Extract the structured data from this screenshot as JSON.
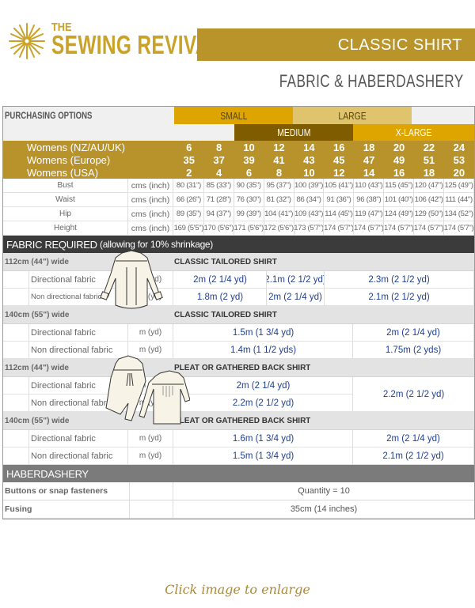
{
  "header": {
    "logo_small": "THE",
    "logo_main": "SEWING REVIVAL",
    "title": "CLASSIC SHIRT",
    "subtitle": "FABRIC & HABERDASHERY"
  },
  "colors": {
    "brand_gold": "#b9942a",
    "small": "#dea400",
    "medium": "#7f5c00",
    "large": "#e0c36d",
    "xlarge": "#dea400",
    "section_dark": "#3b3b3b",
    "section_grey": "#7b7b7b",
    "value_blue": "#1f3f8f"
  },
  "purchasing": {
    "label": "PURCHASING OPTIONS",
    "groups": {
      "small": "SMALL",
      "medium": "MEDIUM",
      "large": "LARGE",
      "xlarge": "X-LARGE"
    }
  },
  "sizes": [
    {
      "label": "Womens (NZ/AU/UK)",
      "values": [
        "6",
        "8",
        "10",
        "12",
        "14",
        "16",
        "18",
        "20",
        "22",
        "24"
      ]
    },
    {
      "label": "Womens (Europe)",
      "values": [
        "35",
        "37",
        "39",
        "41",
        "43",
        "45",
        "47",
        "49",
        "51",
        "53"
      ]
    },
    {
      "label": "Womens (USA)",
      "values": [
        "2",
        "4",
        "6",
        "8",
        "10",
        "12",
        "14",
        "16",
        "18",
        "20"
      ]
    }
  ],
  "measurements": [
    {
      "label": "Bust",
      "unit": "cms (inch)",
      "values": [
        "80 (31\")",
        "85 (33\")",
        "90 (35\")",
        "95 (37\")",
        "100 (39\")",
        "105 (41\")",
        "110 (43\")",
        "115 (45\")",
        "120 (47\")",
        "125 (49\")"
      ]
    },
    {
      "label": "Waist",
      "unit": "cms (inch)",
      "values": [
        "66 (26\")",
        "71 (28\")",
        "76 (30\")",
        "81 (32\")",
        "86 (34\")",
        "91 (36\")",
        "96 (38\")",
        "101 (40\")",
        "106 (42\")",
        "111 (44\")"
      ]
    },
    {
      "label": "Hip",
      "unit": "cms (inch)",
      "values": [
        "89 (35\")",
        "94 (37\")",
        "99 (39\")",
        "104 (41\")",
        "109 (43\")",
        "114 (45\")",
        "119 (47\")",
        "124 (49\")",
        "129 (50\")",
        "134 (52\")"
      ]
    },
    {
      "label": "Height",
      "unit": "cms (inch)",
      "values": [
        "169 (5'5\")",
        "170 (5'6\")",
        "171 (5'6\")",
        "172 (5'6\")",
        "173 (5'7\")",
        "174 (5'7\")",
        "174 (5'7\")",
        "174 (5'7\")",
        "174 (5'7\")",
        "174 (5'7\")"
      ]
    }
  ],
  "fabric": {
    "section_title": "FABRIC REQUIRED",
    "section_note": "(allowing for 10% shrinkage)",
    "blocks": [
      {
        "width": "112cm (44\") wide",
        "style": "CLASSIC TAILORED SHIRT",
        "rows": [
          {
            "label": "Directional fabric",
            "unit": "m (yd)",
            "values": [
              "2m  (2 1/4 yd)",
              "2.1m  (2 1/2 yd)",
              "2.3m (2 1/2 yd)"
            ]
          },
          {
            "label": "Non directional fabric",
            "unit": "m (yd)",
            "values": [
              "1.8m  (2  yd)",
              "2m (2 1/4 yd)",
              "2.1m  (2 1/2 yd)"
            ]
          }
        ]
      },
      {
        "width": "140cm (55\") wide",
        "style": "CLASSIC TAILORED SHIRT",
        "rows": [
          {
            "label": "Directional fabric",
            "unit": "m (yd)",
            "values": [
              "1.5m (1 3/4 yd)",
              "2m (2 1/4 yd)"
            ]
          },
          {
            "label": "Non directional fabric",
            "unit": "m (yd)",
            "values": [
              "1.4m (1 1/2 yds)",
              "1.75m (2 yds)"
            ]
          }
        ]
      },
      {
        "width": "112cm (44\") wide",
        "style": "PLEAT OR GATHERED BACK SHIRT",
        "rows": [
          {
            "label": "Directional fabric",
            "unit": "m (yd)",
            "values": [
              "2m  (2 1/4 yd)"
            ]
          },
          {
            "label": "Non directional fabric",
            "unit": "m (yd)",
            "values": [
              "2.2m  (2 1/2 yd)"
            ]
          }
        ],
        "merged_value": "2.2m  (2 1/2 yd)"
      },
      {
        "width": "140cm (55\") wide",
        "style": "PLEAT OR GATHERED BACK SHIRT",
        "rows": [
          {
            "label": "Directional fabric",
            "unit": "m (yd)",
            "values": [
              "1.6m (1 3/4 yd)",
              "2m (2 1/4 yd)"
            ]
          },
          {
            "label": "Non directional fabric",
            "unit": "m (yd)",
            "values": [
              "1.5m (1 3/4 yd)",
              "2.1m  (2 1/2 yd)"
            ]
          }
        ]
      }
    ]
  },
  "haberdashery": {
    "section_title": "HABERDASHERY",
    "rows": [
      {
        "label": "Buttons or snap fasteners",
        "value": "Quantity = 10"
      },
      {
        "label": "Fusing",
        "value": "35cm (14 inches)"
      }
    ]
  },
  "footer": {
    "link": "Click image to enlarge"
  }
}
